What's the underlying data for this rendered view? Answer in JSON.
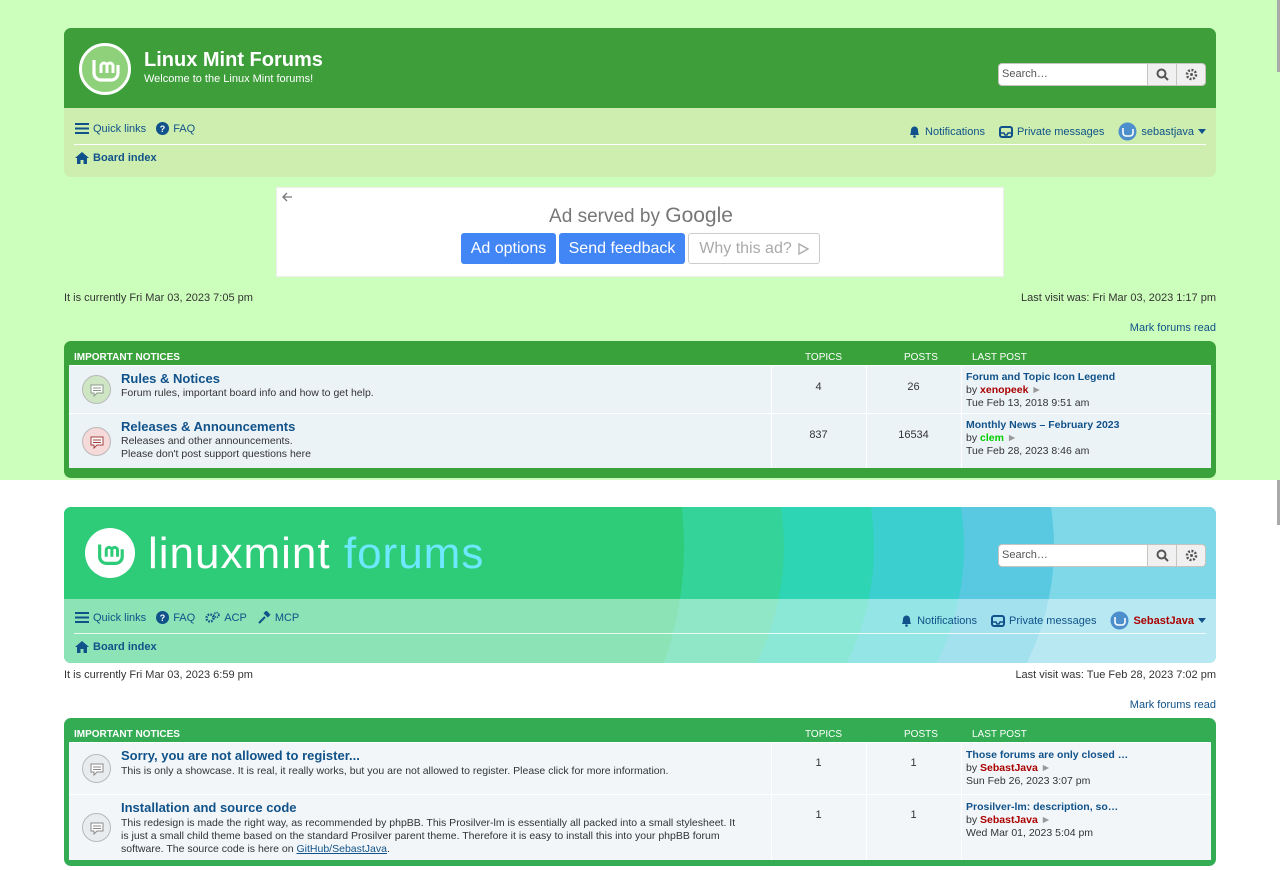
{
  "top": {
    "site_name": "Linux Mint Forums",
    "site_desc": "Welcome to the Linux Mint forums!",
    "search_placeholder": "Search…",
    "quick_links": "Quick links",
    "faq": "FAQ",
    "notifications": "Notifications",
    "private_messages": "Private messages",
    "username": "sebastjava",
    "board_index": "Board index",
    "ad": {
      "served_prefix": "Ad served by",
      "served_brand": "Google",
      "options": "Ad options",
      "feedback": "Send feedback",
      "why": "Why this ad?"
    },
    "current_time": "It is currently Fri Mar 03, 2023 7:05 pm",
    "last_visit": "Last visit was: Fri Mar 03, 2023 1:17 pm",
    "mark_read": "Mark forums read",
    "table_head": {
      "category": "IMPORTANT NOTICES",
      "topics": "TOPICS",
      "posts": "POSTS",
      "last_post": "LAST POST"
    },
    "forums": [
      {
        "title": "Rules & Notices",
        "desc1": "Forum rules, important board info and how to get help.",
        "desc2": "",
        "topics": "4",
        "posts": "26",
        "lp_title": "Forum and Topic Icon Legend",
        "by": "by",
        "lp_user": "xenopeek",
        "lp_date": "Tue Feb 13, 2018 9:51 am",
        "user_color": "#aa0000",
        "icon_color": "#cfe6c4"
      },
      {
        "title": "Releases & Announcements",
        "desc1": "Releases and other announcements.",
        "desc2": "Please don't post support questions here",
        "topics": "837",
        "posts": "16534",
        "lp_title": "Monthly News – February 2023",
        "by": "by",
        "lp_user": "clem",
        "lp_date": "Tue Feb 28, 2023 8:46 am",
        "user_color": "#00cc00",
        "icon_color": "#f6d9d9"
      }
    ]
  },
  "bottom": {
    "logo_word1": "linuxmint",
    "logo_word2": "forums",
    "search_placeholder": "Search…",
    "quick_links": "Quick links",
    "faq": "FAQ",
    "acp": "ACP",
    "mcp": "MCP",
    "notifications": "Notifications",
    "private_messages": "Private messages",
    "username": "SebastJava",
    "board_index": "Board index",
    "current_time": "It is currently Fri Mar 03, 2023 6:59 pm",
    "last_visit": "Last visit was: Tue Feb 28, 2023 7:02 pm",
    "mark_read": "Mark forums read",
    "table_head": {
      "category": "IMPORTANT NOTICES",
      "topics": "TOPICS",
      "posts": "POSTS",
      "last_post": "LAST POST"
    },
    "forums": [
      {
        "title": "Sorry, you are not allowed to register...",
        "desc1": "This is only a showcase. It is real, it really works, but you are not allowed to register. Please click for more information.",
        "topics": "1",
        "posts": "1",
        "lp_title": "Those forums are only closed …",
        "by": "by",
        "lp_user": "SebastJava",
        "lp_date": "Sun Feb 26, 2023 3:07 pm"
      },
      {
        "title": "Installation and source code",
        "desc1": "This redesign is made the right way, as recommended by phpBB. This Prosilver-lm is essentially all packed into a small stylesheet. It",
        "desc2": "is just a small child theme based on the standard Prosilver parent theme. Therefore it is easy to install this into your phpBB forum",
        "desc3": "software. The source code is here on",
        "link": "GitHub/SebastJava",
        "desc4": ".",
        "topics": "1",
        "posts": "1",
        "lp_title": "Prosilver-lm: description, so…",
        "by": "by",
        "lp_user": "SebastJava",
        "lp_date": "Wed Mar 01, 2023 5:04 pm"
      }
    ]
  }
}
